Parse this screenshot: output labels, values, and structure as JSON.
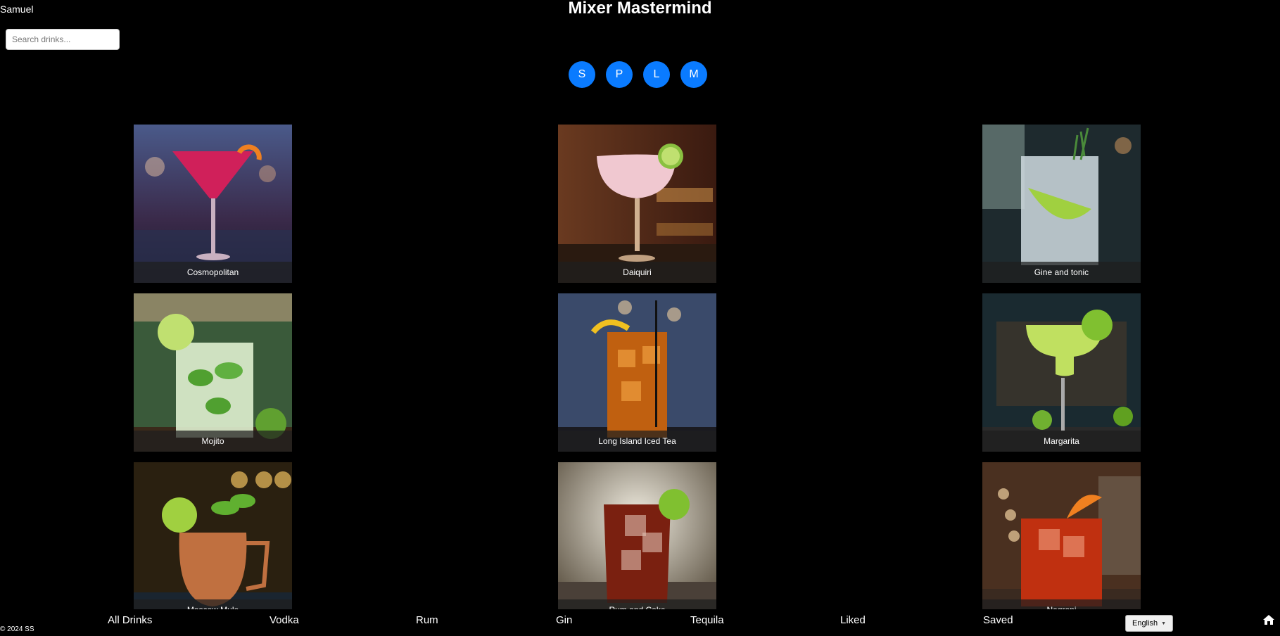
{
  "header": {
    "username": "Samuel",
    "title": "Mixer Mastermind",
    "search": {
      "placeholder": "Search drinks...",
      "value": ""
    },
    "filters": [
      {
        "label": "S",
        "color": "#0a7bff"
      },
      {
        "label": "P",
        "color": "#0a7bff"
      },
      {
        "label": "L",
        "color": "#0a7bff"
      },
      {
        "label": "M",
        "color": "#0a7bff"
      }
    ]
  },
  "drinks": [
    {
      "name": "Cosmopolitan",
      "image": "cosmopolitan-martini-glass-icon"
    },
    {
      "name": "Daiquiri",
      "image": "daiquiri-coupe-glass-icon"
    },
    {
      "name": "Gine and tonic",
      "image": "gin-tonic-highball-icon"
    },
    {
      "name": "Mojito",
      "image": "mojito-glass-icon"
    },
    {
      "name": "Long Island Iced Tea",
      "image": "long-island-iced-tea-icon"
    },
    {
      "name": "Margarita",
      "image": "margarita-glass-icon"
    },
    {
      "name": "Moscow Mule",
      "image": "moscow-mule-copper-mug-icon"
    },
    {
      "name": "Rum and Coke",
      "image": "rum-and-coke-glass-icon"
    },
    {
      "name": "Negroni",
      "image": "negroni-rocks-glass-icon"
    }
  ],
  "footer": {
    "nav": [
      "All Drinks",
      "Vodka",
      "Rum",
      "Gin",
      "Tequila",
      "Liked",
      "Saved"
    ],
    "copyright": "© 2024 SS",
    "language": "English",
    "home_icon": "home-icon"
  }
}
